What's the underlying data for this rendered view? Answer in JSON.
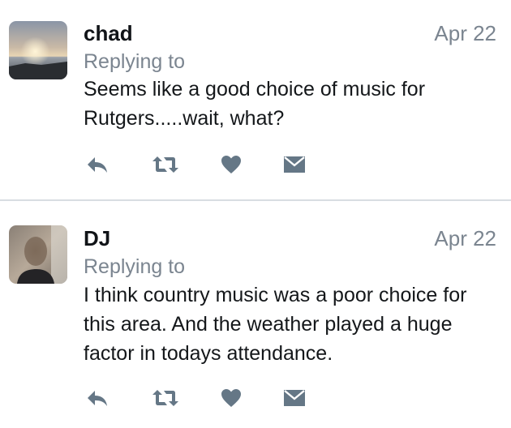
{
  "colors": {
    "name": "#111418",
    "secondary": "#7b8590",
    "body": "#14171a",
    "icon": "#657786",
    "divider": "#d8dde2"
  },
  "tweets": [
    {
      "author": "chad",
      "date": "Apr 22",
      "replying": "Replying to",
      "text": "Seems like a good choice of music for Rutgers.....wait, what?",
      "avatar": "sunset-avatar",
      "icons": [
        "reply-icon",
        "retweet-icon",
        "heart-icon",
        "envelope-icon"
      ]
    },
    {
      "author": "DJ",
      "date": "Apr 22",
      "replying": "Replying to",
      "text": "I think country music was a poor choice for this area. And the weather played a huge factor in todays attendance.",
      "avatar": "blurred-person-avatar",
      "icons": [
        "reply-icon",
        "retweet-icon",
        "heart-icon",
        "envelope-icon"
      ]
    }
  ]
}
